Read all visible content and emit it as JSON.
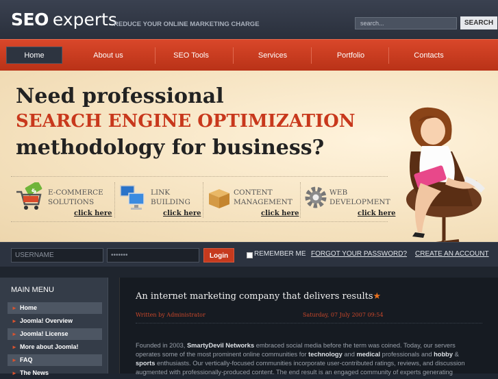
{
  "header": {
    "logo_seo": "SEO",
    "logo_experts": "experts",
    "tagline": "REDUCE YOUR ONLINE MARKETING CHARGE",
    "search_placeholder": "search...",
    "search_button": "SEARCH"
  },
  "nav": {
    "items": [
      {
        "label": "Home"
      },
      {
        "label": "About us"
      },
      {
        "label": "SEO Tools"
      },
      {
        "label": "Services"
      },
      {
        "label": "Portfolio"
      },
      {
        "label": "Contacts"
      }
    ]
  },
  "banner": {
    "line1": "Need professional",
    "line2": "SEARCH ENGINE OPTIMIZATION",
    "line3": "methodology for business?",
    "services": [
      {
        "line1": "E-COMMERCE",
        "line2": "SOLUTIONS",
        "link": "click here",
        "icon": "cart-icon"
      },
      {
        "line1": "LINK",
        "line2": "BUILDING",
        "link": "click here",
        "icon": "computers-icon"
      },
      {
        "line1": "CONTENT",
        "line2": "MANAGEMENT",
        "link": "click here",
        "icon": "box-icon"
      },
      {
        "line1": "WEB",
        "line2": "DEVELOPMENT",
        "link": "click here",
        "icon": "gear-icon"
      }
    ]
  },
  "login": {
    "username_placeholder": "USERNAME",
    "password_value": "•••••••",
    "button": "Login",
    "remember": "REMEMBER ME",
    "forgot": "FORGOT YOUR PASSWORD?",
    "create": "CREATE AN ACCOUNT"
  },
  "menu": {
    "title": "MAIN MENU",
    "items": [
      {
        "label": "Home"
      },
      {
        "label": "Joomla! Overview"
      },
      {
        "label": "Joomla! License"
      },
      {
        "label": "More about Joomla!"
      },
      {
        "label": "FAQ"
      },
      {
        "label": "The News"
      }
    ]
  },
  "article": {
    "title": "An internet marketing company that delivers results",
    "author": "Written by Administrator",
    "date": "Saturday, 07 July 2007 09:54",
    "body_1": "Founded in 2003, ",
    "body_b1": "SmartyDevil Networks",
    "body_2": " embraced social media before the term was coined. Today, our servers operates some of the most prominent online communities for ",
    "body_b2": "technology",
    "body_3": " and ",
    "body_b3": "medical",
    "body_4": " professionals and ",
    "body_b4": "hobby",
    "body_5": " & ",
    "body_b5": "sports",
    "body_6": " enthusiasts. Our vertically-focused communities incorporate user-contributed ratings, reviews, and discussion augmented with professionally-produced content. The end result is an engaged community of experts generating"
  },
  "colors": {
    "accent": "#c8381c",
    "header_bg": "#2a303c"
  }
}
